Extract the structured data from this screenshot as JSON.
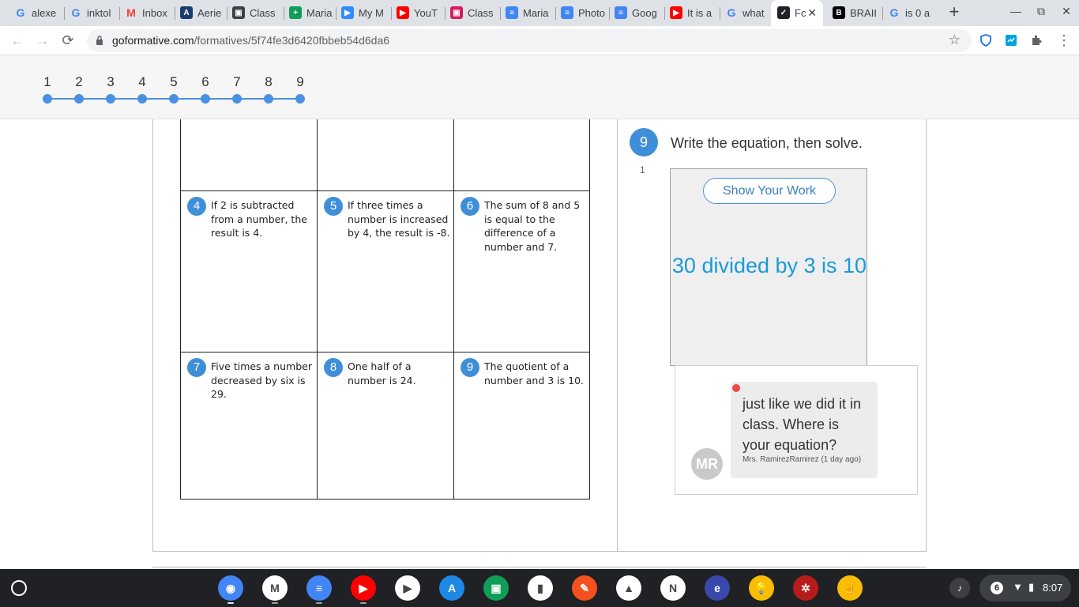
{
  "browser": {
    "tabs": [
      {
        "label": "alexe",
        "icon": "google-icon",
        "color": "#4285f4",
        "glyph": "G"
      },
      {
        "label": "inktol",
        "icon": "google-icon",
        "color": "#4285f4",
        "glyph": "G"
      },
      {
        "label": "Inbox",
        "icon": "gmail-icon",
        "color": "#ea4335",
        "glyph": "M"
      },
      {
        "label": "Aerie",
        "icon": "aeries-icon",
        "color": "#1a3d6d",
        "glyph": "A"
      },
      {
        "label": "Class",
        "icon": "classroom-icon",
        "color": "#3c4043",
        "glyph": "▣"
      },
      {
        "label": "Maria",
        "icon": "sheets-icon",
        "color": "#0f9d58",
        "glyph": "+"
      },
      {
        "label": "My M",
        "icon": "zoom-icon",
        "color": "#2d8cff",
        "glyph": "▶"
      },
      {
        "label": "YouT",
        "icon": "youtube-icon",
        "color": "#ff0000",
        "glyph": "▶"
      },
      {
        "label": "Class",
        "icon": "classdojo-icon",
        "color": "#d81b60",
        "glyph": "▣"
      },
      {
        "label": "Maria",
        "icon": "docs-icon",
        "color": "#4285f4",
        "glyph": "≡"
      },
      {
        "label": "Photo",
        "icon": "docs-icon",
        "color": "#4285f4",
        "glyph": "≡"
      },
      {
        "label": "Goog",
        "icon": "docs-icon",
        "color": "#4285f4",
        "glyph": "≡"
      },
      {
        "label": "It is a",
        "icon": "youtube-icon",
        "color": "#ff0000",
        "glyph": "▶"
      },
      {
        "label": "what",
        "icon": "google-icon",
        "color": "#4285f4",
        "glyph": "G"
      },
      {
        "label": "Fc",
        "icon": "formative-icon",
        "color": "#202124",
        "glyph": "✓"
      },
      {
        "label": "BRAII",
        "icon": "brainly-icon",
        "color": "#000000",
        "glyph": "B"
      },
      {
        "label": "is 0 a",
        "icon": "google-icon",
        "color": "#4285f4",
        "glyph": "G"
      }
    ],
    "url_host": "goformative.com",
    "url_path": "/formatives/5f74fe3d6420fbbeb54d6da6"
  },
  "question_nav": {
    "numbers": [
      "1",
      "2",
      "3",
      "4",
      "5",
      "6",
      "7",
      "8",
      "9"
    ],
    "accent": "#4a90e2"
  },
  "worksheet": {
    "problems": [
      {
        "num": "4",
        "text": "If 2 is subtracted from a number, the result is 4."
      },
      {
        "num": "5",
        "text": "If three times a number is increased by 4, the result is -8."
      },
      {
        "num": "6",
        "text": "The sum of 8 and 5 is equal to the difference of a number and 7."
      },
      {
        "num": "7",
        "text": "Five times a number decreased by six is 29."
      },
      {
        "num": "8",
        "text": "One half of a number is 24."
      },
      {
        "num": "9",
        "text": "The quotient of a number and 3 is 10."
      }
    ]
  },
  "question": {
    "number": "9",
    "prompt": "Write the equation, then solve.",
    "points": "1",
    "show_work_label": "Show Your Work",
    "answer": "30 divided by 3 is 10"
  },
  "comment": {
    "avatar_initials": "MR",
    "text": "just like we did it in class. Where is your equation?",
    "meta": "Mrs. RamirezRamirez (1 day ago)"
  },
  "shelf": {
    "apps": [
      {
        "name": "chrome-app-icon",
        "color": "#4285f4",
        "glyph": "◉"
      },
      {
        "name": "gmail-app-icon",
        "color": "#ffffff",
        "glyph": "M"
      },
      {
        "name": "docs-app-icon",
        "color": "#4285f4",
        "glyph": "≡"
      },
      {
        "name": "youtube-app-icon",
        "color": "#ff0000",
        "glyph": "▶"
      },
      {
        "name": "play-store-app-icon",
        "color": "#ffffff",
        "glyph": "▶"
      },
      {
        "name": "aeries-app-icon",
        "color": "#1e88e5",
        "glyph": "A"
      },
      {
        "name": "classroom-app-icon",
        "color": "#0f9d58",
        "glyph": "▣"
      },
      {
        "name": "notebook-app-icon",
        "color": "#ffffff",
        "glyph": "▮"
      },
      {
        "name": "pencil-app-icon",
        "color": "#f4511e",
        "glyph": "✎"
      },
      {
        "name": "drive-app-icon",
        "color": "#ffffff",
        "glyph": "▲"
      },
      {
        "name": "nearpod-app-icon",
        "color": "#ffffff",
        "glyph": "N"
      },
      {
        "name": "edge-app-icon",
        "color": "#3949ab",
        "glyph": "e"
      },
      {
        "name": "keep-app-icon",
        "color": "#fbbc04",
        "glyph": "💡"
      },
      {
        "name": "red-app-icon",
        "color": "#b71c1c",
        "glyph": "✲"
      },
      {
        "name": "touch-app-icon",
        "color": "#fbbc04",
        "glyph": "☝"
      }
    ],
    "notification_count": "6",
    "time": "8:07"
  }
}
